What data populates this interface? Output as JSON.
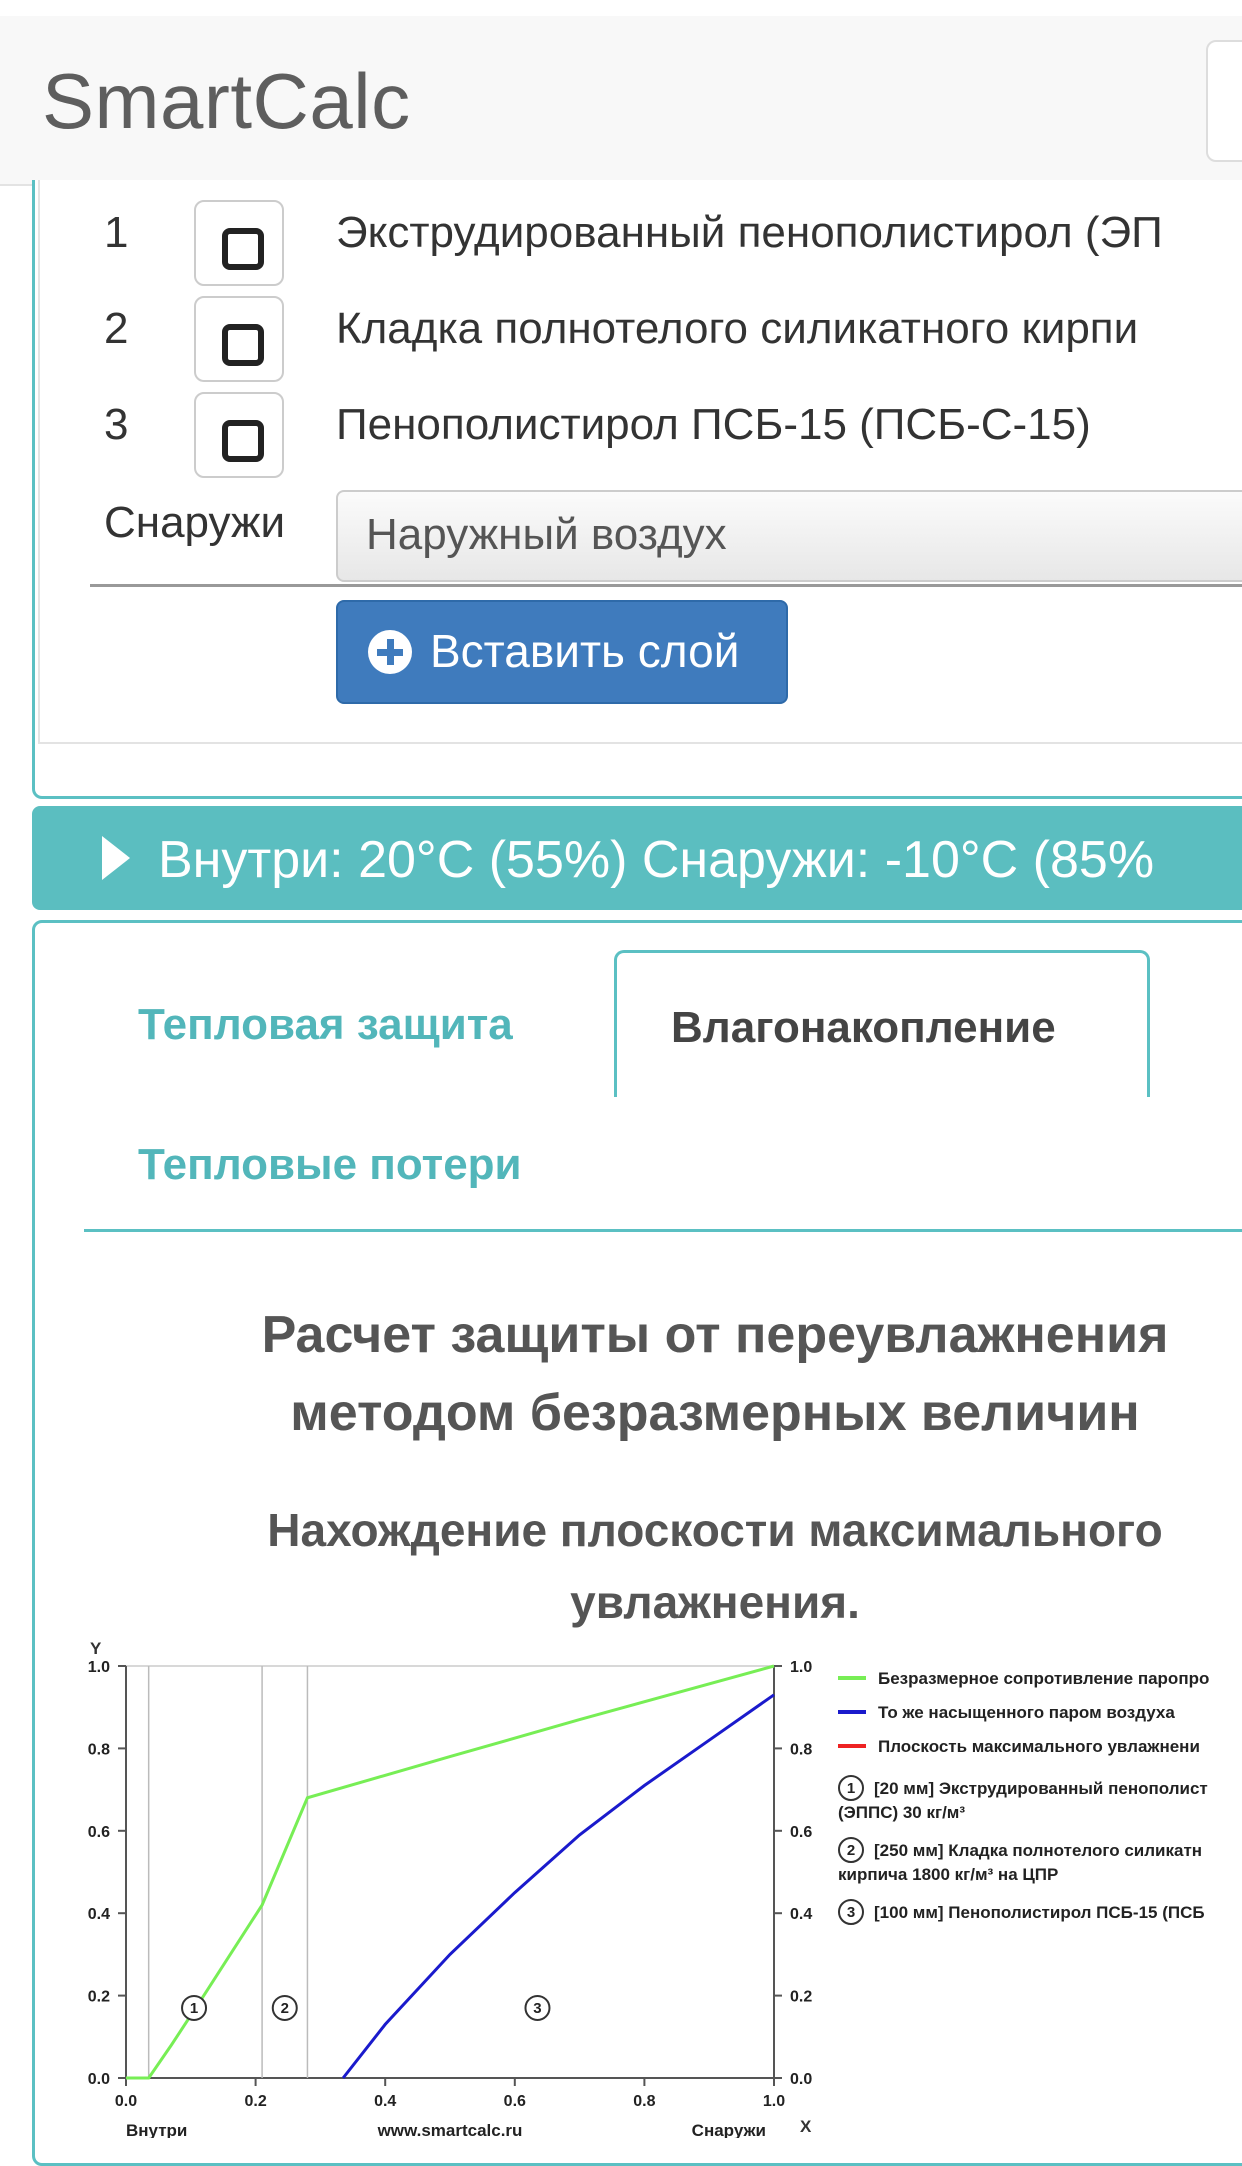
{
  "app": {
    "brand": "SmartCalc"
  },
  "layers": [
    {
      "num": "1",
      "name": "Экструдированный пенополистирол (ЭП"
    },
    {
      "num": "2",
      "name": "Кладка полнотелого силикатного кирпи"
    },
    {
      "num": "3",
      "name": "Пенополистирол ПСБ-15 (ПСБ-С-15)"
    }
  ],
  "outside": {
    "label": "Снаружи",
    "value": "Наружный воздух"
  },
  "insert_button": {
    "label": "Вставить слой"
  },
  "conditions": {
    "text": "Внутри: 20°C (55%) Снаружи: -10°C (85%"
  },
  "tabs": [
    {
      "label": "Тепловая защита"
    },
    {
      "label": "Влагонакопление",
      "active": true
    },
    {
      "label": "Тепловые потери"
    }
  ],
  "heading": {
    "line1": "Расчет защиты от переувлажнения",
    "line2": "методом безразмерных величин"
  },
  "subheading": {
    "line1": "Нахождение плоскости максимального",
    "line2": "увлажнения."
  },
  "chart_data": {
    "type": "line",
    "y_axis_label": "Y",
    "x_axis_label": "X",
    "xlim": [
      0,
      1
    ],
    "ylim": [
      0,
      1
    ],
    "x_ticks": [
      "0.0",
      "0.2",
      "0.4",
      "0.6",
      "0.8",
      "1.0"
    ],
    "y_ticks": [
      "0.0",
      "0.2",
      "0.4",
      "0.6",
      "0.8",
      "1.0"
    ],
    "bottom_labels": {
      "left": "Внутри",
      "center": "www.smartcalc.ru",
      "right": "Снаружи"
    },
    "layer_boundaries": [
      0.035,
      0.21,
      0.28
    ],
    "layer_markers": [
      {
        "label": "1",
        "x": 0.105,
        "y": 0.17
      },
      {
        "label": "2",
        "x": 0.245,
        "y": 0.17
      },
      {
        "label": "3",
        "x": 0.635,
        "y": 0.17
      }
    ],
    "series": [
      {
        "name": "Безразмерное сопротивление паропро",
        "color": "#77ee55",
        "x": [
          0,
          0.035,
          0.07,
          0.12,
          0.21,
          0.28,
          0.5,
          0.7,
          1.0
        ],
        "y": [
          0,
          0,
          0.08,
          0.2,
          0.42,
          0.68,
          0.78,
          0.87,
          1.0
        ]
      },
      {
        "name": "То же насыщенного паром воздуха",
        "color": "#1a1acc",
        "x": [
          0.335,
          0.4,
          0.5,
          0.6,
          0.7,
          0.8,
          0.9,
          1.0
        ],
        "y": [
          0,
          0.13,
          0.3,
          0.45,
          0.59,
          0.71,
          0.82,
          0.93
        ]
      },
      {
        "name": "Плоскость максимального увлажнени",
        "color": "#ee2222",
        "x": [],
        "y": []
      }
    ],
    "legend_layers": [
      {
        "num": "1",
        "text1": "[20 мм] Экструдированный пенополист",
        "text2": "(ЭППС) 30 кг/м³"
      },
      {
        "num": "2",
        "text1": "[250 мм] Кладка полнотелого силикатн",
        "text2": "кирпича 1800 кг/м³ на ЦПР"
      },
      {
        "num": "3",
        "text1": "[100 мм] Пенополистирол ПСБ-15 (ПСБ",
        "text2": ""
      }
    ]
  }
}
